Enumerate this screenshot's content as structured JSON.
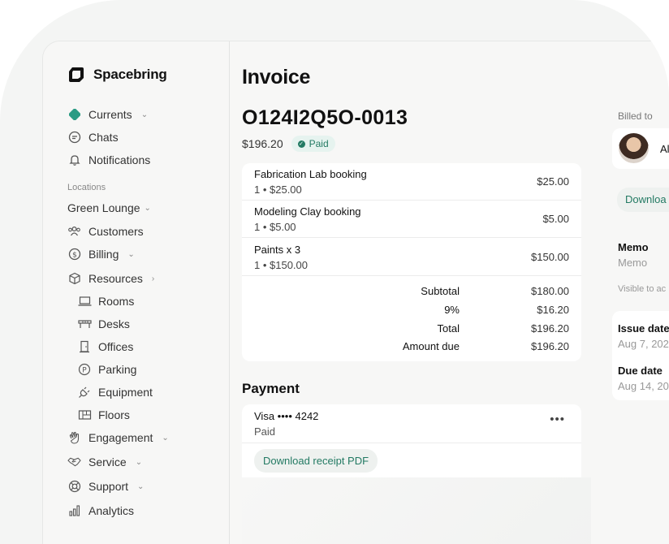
{
  "brand": {
    "name": "Spacebring"
  },
  "sidebar": {
    "top_items": [
      {
        "label": "Currents",
        "icon": "currents-icon",
        "has_chevron": true
      },
      {
        "label": "Chats",
        "icon": "chat-bubble-icon"
      },
      {
        "label": "Notifications",
        "icon": "bell-icon"
      }
    ],
    "locations_label": "Locations",
    "location": "Green Lounge",
    "items": [
      {
        "label": "Customers",
        "icon": "users-icon"
      },
      {
        "label": "Billing",
        "icon": "dollar-circle-icon"
      },
      {
        "label": "Resources",
        "icon": "cube-icon"
      }
    ],
    "resources": [
      {
        "label": "Rooms",
        "icon": "room-icon"
      },
      {
        "label": "Desks",
        "icon": "desk-icon"
      },
      {
        "label": "Offices",
        "icon": "door-icon"
      },
      {
        "label": "Parking",
        "icon": "parking-icon"
      },
      {
        "label": "Equipment",
        "icon": "plug-icon"
      },
      {
        "label": "Floors",
        "icon": "floor-plan-icon"
      }
    ],
    "bottom_items": [
      {
        "label": "Engagement",
        "icon": "hand-wave-icon"
      },
      {
        "label": "Service",
        "icon": "handshake-icon"
      },
      {
        "label": "Support",
        "icon": "lifebuoy-icon"
      },
      {
        "label": "Analytics",
        "icon": "bar-chart-icon"
      }
    ]
  },
  "main": {
    "title": "Invoice",
    "invoice_id": "O124I2Q5O-0013",
    "amount": "$196.20",
    "status": "Paid",
    "line_items": [
      {
        "name": "Fabrication Lab booking",
        "qty_price": "1 • $25.00",
        "total": "$25.00"
      },
      {
        "name": "Modeling Clay booking",
        "qty_price": "1 • $5.00",
        "total": "$5.00"
      },
      {
        "name": "Paints x 3",
        "qty_price": "1 • $150.00",
        "total": "$150.00"
      }
    ],
    "totals": [
      {
        "label": "Subtotal",
        "value": "$180.00"
      },
      {
        "label": "9%",
        "value": "$16.20"
      },
      {
        "label": "Total",
        "value": "$196.20"
      },
      {
        "label": "Amount due",
        "value": "$196.20"
      }
    ],
    "payment": {
      "title": "Payment",
      "method": "Visa •••• 4242",
      "status": "Paid",
      "more": "•••",
      "receipt_button": "Download receipt PDF"
    }
  },
  "right_panel": {
    "billed_to_label": "Billed to",
    "billed_name": "Al",
    "download_button": "Downloa",
    "memo_label": "Memo",
    "memo_placeholder": "Memo",
    "visible_note": "Visible to ac",
    "issue_date_label": "Issue date",
    "issue_date": "Aug 7, 202",
    "due_date_label": "Due date",
    "due_date": "Aug 14, 20"
  },
  "colors": {
    "accent": "#237a63",
    "badge_bg": "#e6f3ef",
    "currents_icon": "#2a9b84"
  }
}
